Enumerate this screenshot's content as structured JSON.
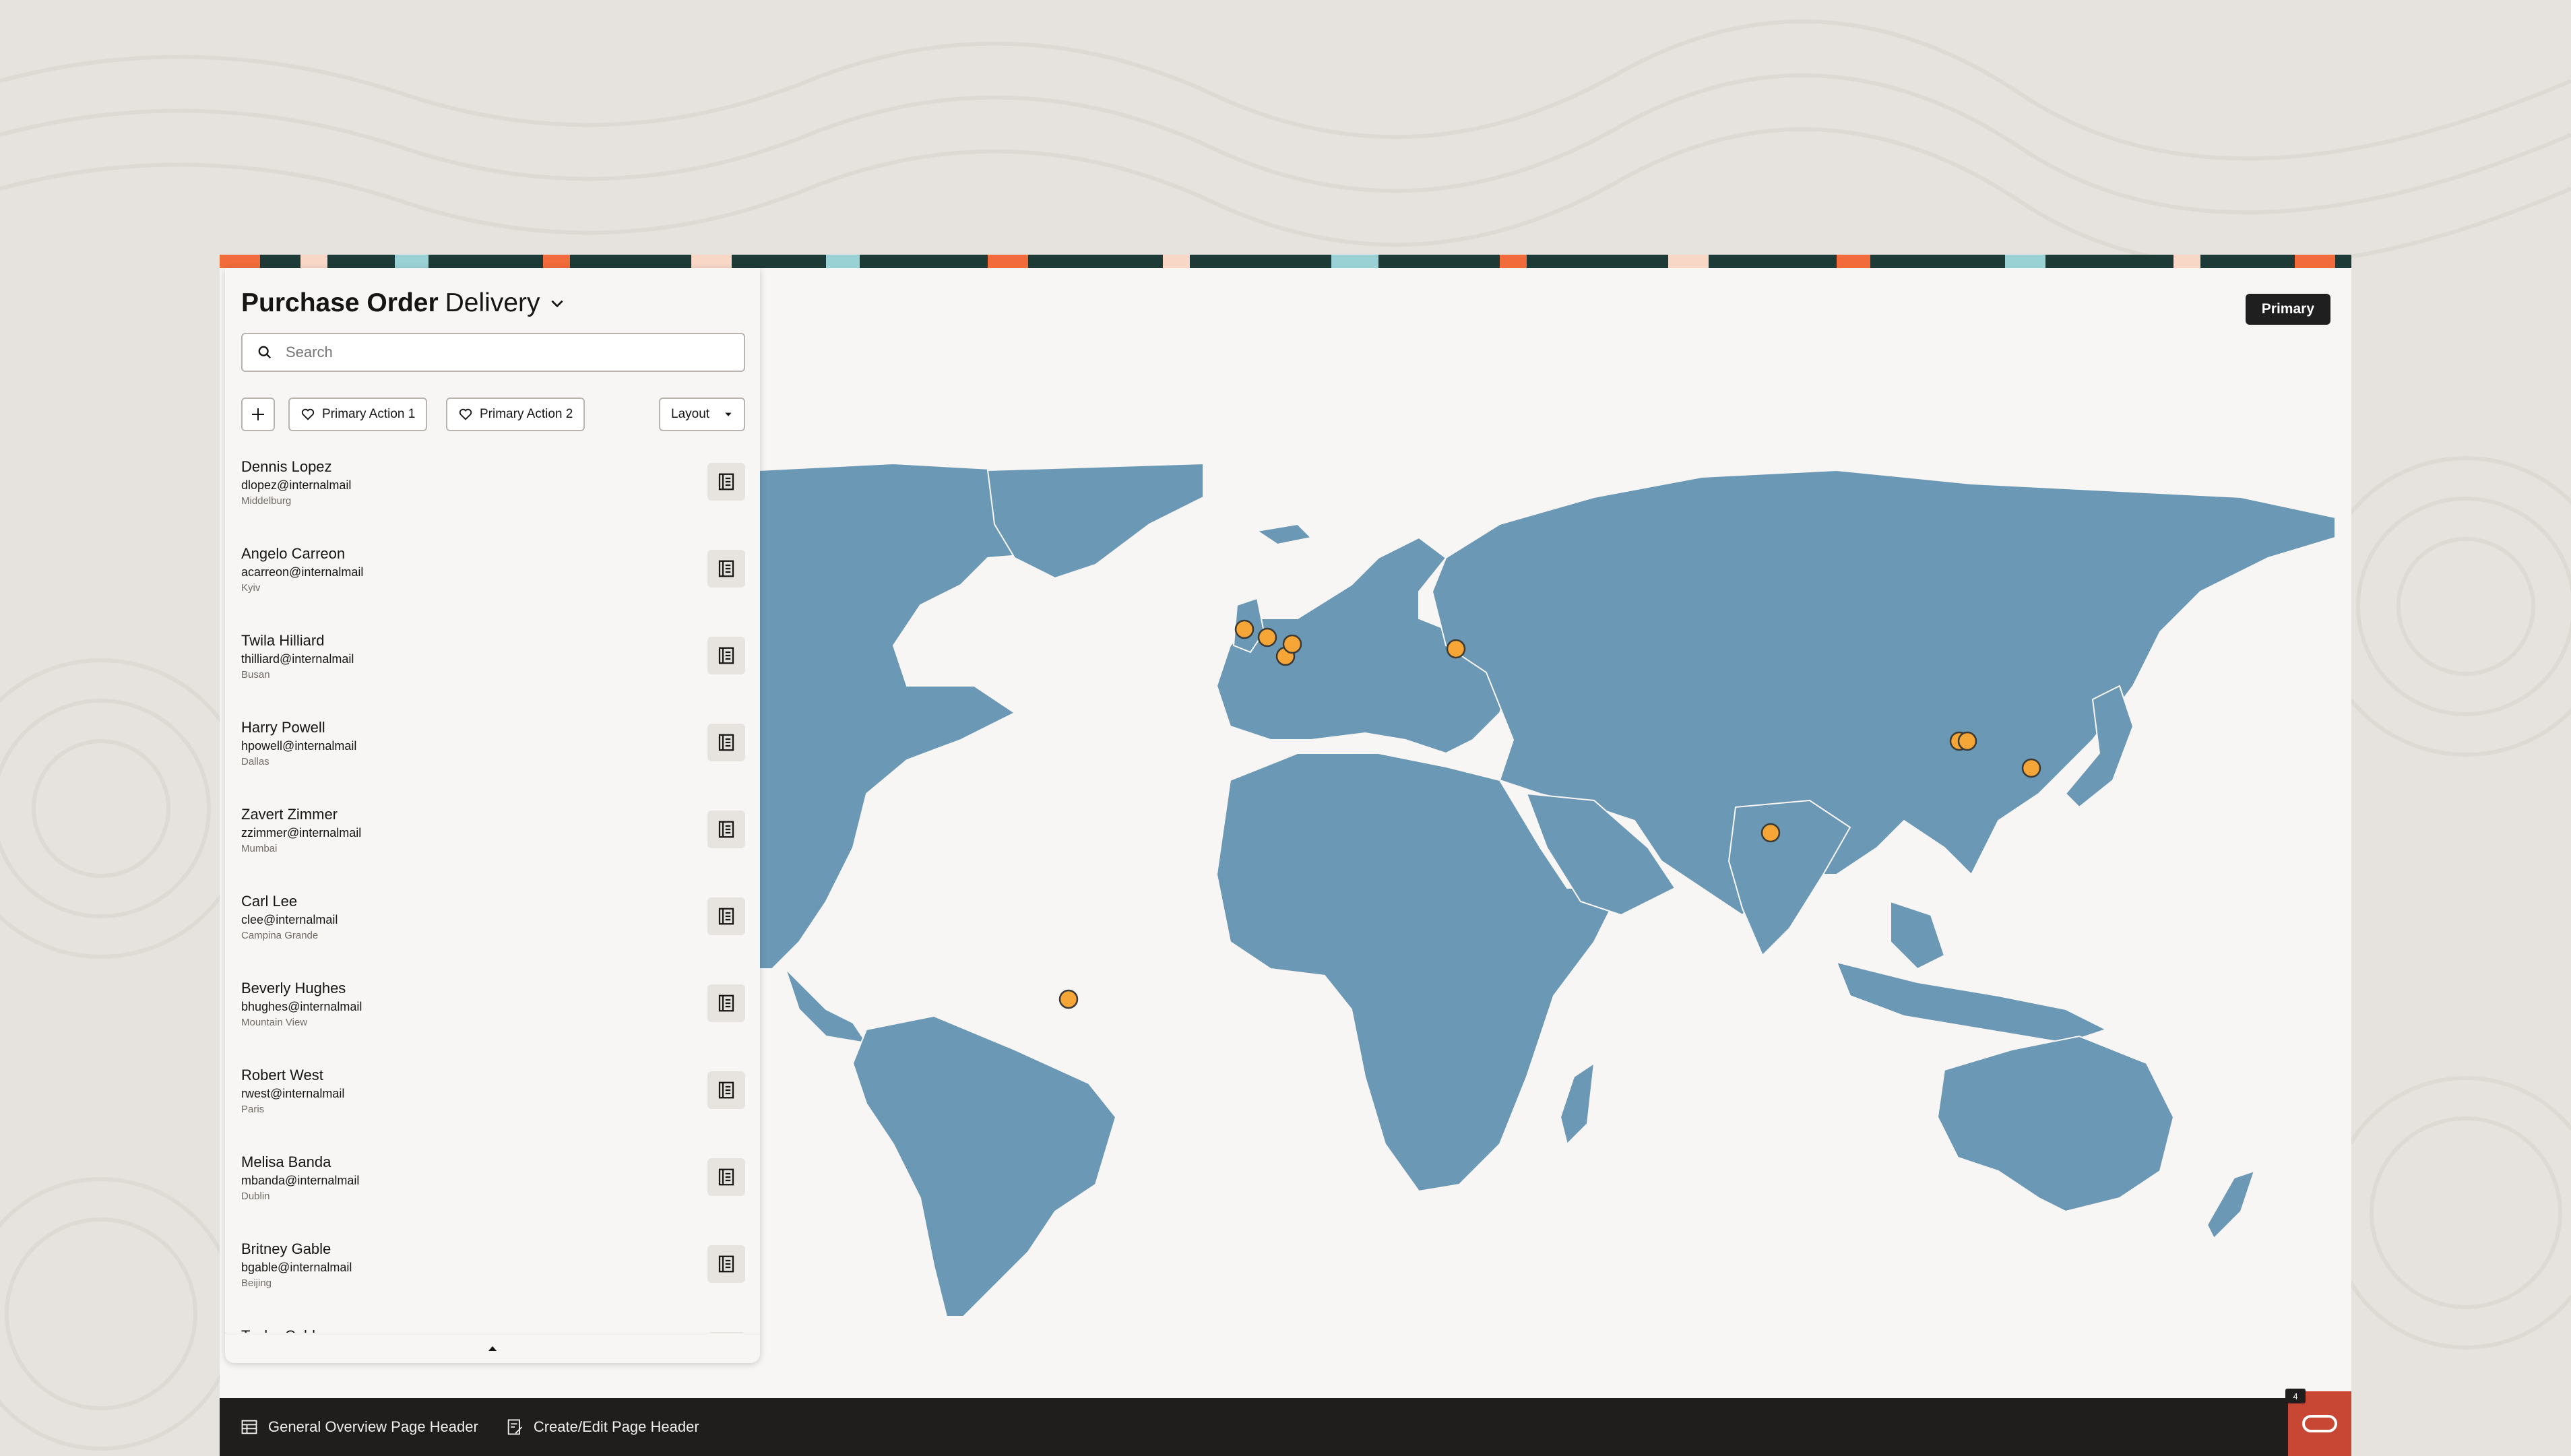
{
  "panel": {
    "title_bold": "Purchase Order",
    "title_regular": "Delivery",
    "search_placeholder": "Search",
    "primary_action_1": "Primary Action 1",
    "primary_action_2": "Primary Action 2",
    "layout_label": "Layout"
  },
  "map_header": {
    "primary_label": "Primary"
  },
  "contacts": [
    {
      "name": "Dennis Lopez",
      "email": "dlopez@internalmail",
      "city": "Middelburg"
    },
    {
      "name": "Angelo Carreon",
      "email": "acarreon@internalmail",
      "city": "Kyiv"
    },
    {
      "name": "Twila Hilliard",
      "email": "thilliard@internalmail",
      "city": "Busan"
    },
    {
      "name": "Harry Powell",
      "email": "hpowell@internalmail",
      "city": "Dallas"
    },
    {
      "name": "Zavert Zimmer",
      "email": "zzimmer@internalmail",
      "city": "Mumbai"
    },
    {
      "name": "Carl Lee",
      "email": "clee@internalmail",
      "city": "Campina Grande"
    },
    {
      "name": "Beverly Hughes",
      "email": "bhughes@internalmail",
      "city": "Mountain View"
    },
    {
      "name": "Robert West",
      "email": "rwest@internalmail",
      "city": "Paris"
    },
    {
      "name": "Melisa Banda",
      "email": "mbanda@internalmail",
      "city": "Dublin"
    },
    {
      "name": "Britney Gable",
      "email": "bgable@internalmail",
      "city": "Beijing"
    },
    {
      "name": "Tasha Cobb",
      "email": "",
      "city": ""
    }
  ],
  "footer": {
    "link1": "General Overview Page Header",
    "link2": "Create/Edit Page Header",
    "badge": "4"
  },
  "colors": {
    "land": "#6b98b4",
    "marker": "#f5a636",
    "footer_bg": "#201e1c",
    "oracle": "#c74634"
  },
  "icons": [
    "search-icon",
    "plus-icon",
    "heart-icon",
    "caret-down-icon",
    "document-icon",
    "chevron-up-icon",
    "table-icon",
    "edit-form-icon",
    "oracle-logo-icon"
  ]
}
